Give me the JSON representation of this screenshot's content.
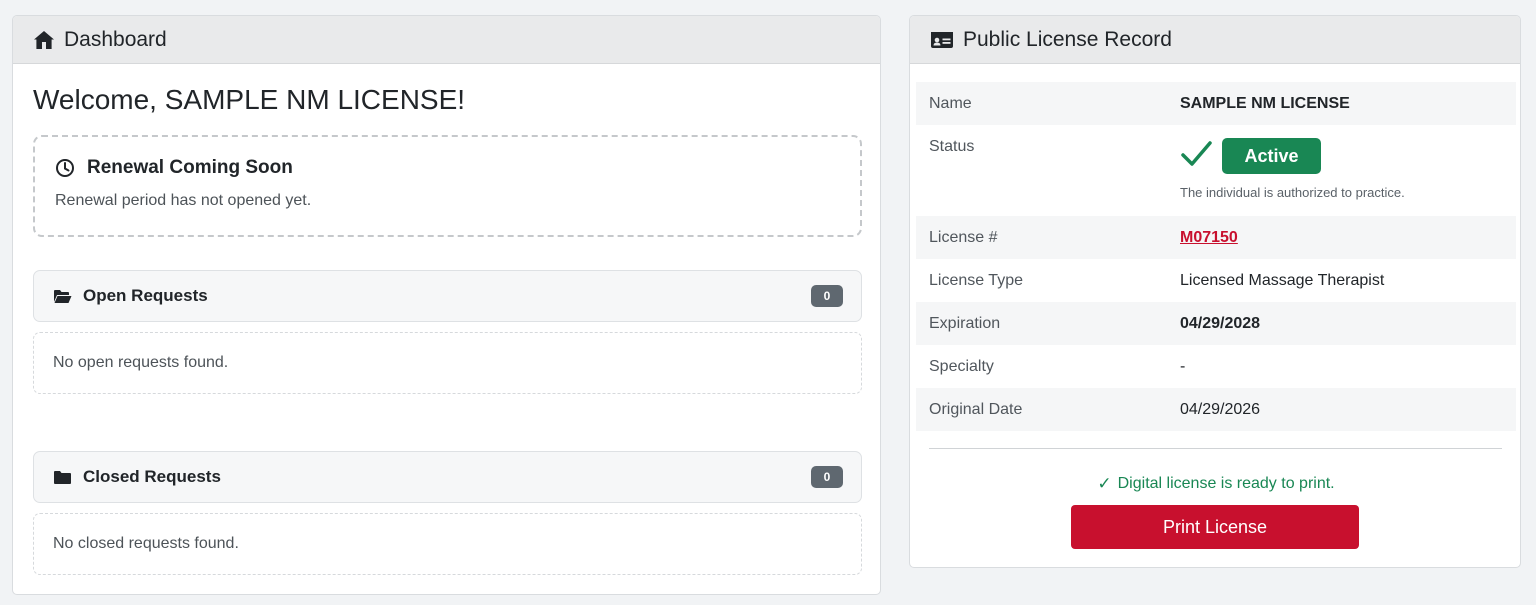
{
  "dashboard": {
    "header_title": "Dashboard",
    "welcome": "Welcome, SAMPLE NM LICENSE!",
    "renewal": {
      "title": "Renewal Coming Soon",
      "text": "Renewal period has not opened yet."
    },
    "open_requests": {
      "title": "Open Requests",
      "count": "0",
      "empty_text": "No open requests found."
    },
    "closed_requests": {
      "title": "Closed Requests",
      "count": "0",
      "empty_text": "No closed requests found."
    }
  },
  "record": {
    "header_title": "Public License Record",
    "rows": {
      "name": {
        "label": "Name",
        "value": "SAMPLE NM LICENSE"
      },
      "status": {
        "label": "Status",
        "value": "Active",
        "note": "The individual is authorized to practice."
      },
      "license_number": {
        "label": "License #",
        "value": "M07150"
      },
      "license_type": {
        "label": "License Type",
        "value": "Licensed Massage Therapist"
      },
      "expiration": {
        "label": "Expiration",
        "value": "04/29/2028"
      },
      "specialty": {
        "label": "Specialty",
        "value": "-"
      },
      "original_date": {
        "label": "Original Date",
        "value": "04/29/2026"
      }
    },
    "ready_text": "Digital license is ready to print.",
    "print_button": "Print License"
  },
  "colors": {
    "accent_red": "#c8102e",
    "success_green": "#198754",
    "badge_gray": "#5f6870"
  },
  "icons": {
    "dashboard": "home-icon",
    "record": "id-card-icon",
    "renewal": "clock-icon",
    "requests": "folder-icon",
    "status": "checkmark-icon"
  }
}
